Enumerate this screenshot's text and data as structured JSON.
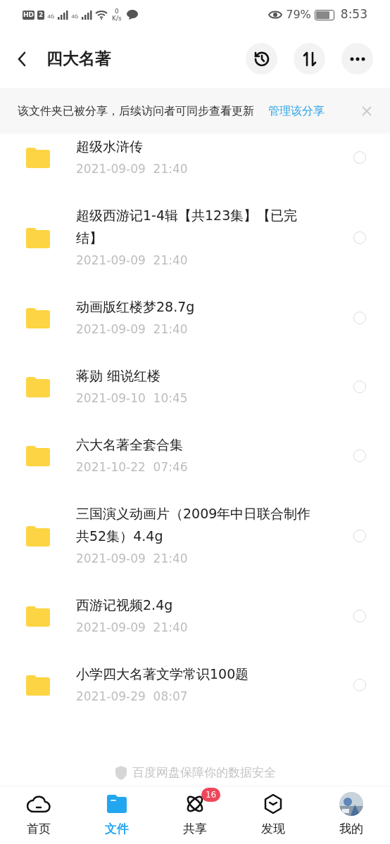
{
  "status_bar": {
    "hd": "HD",
    "sim": "2",
    "net1": "4G",
    "net2": "4G",
    "speed": "0",
    "speed_unit": "K/s",
    "battery": "79%",
    "time": "8:53"
  },
  "header": {
    "title": "四大名著"
  },
  "share_notice": {
    "text": "该文件夹已被分享，后续访问者可同步查看更新",
    "link": "管理该分享"
  },
  "files": [
    {
      "name": "超级水浒传",
      "date": "2021-09-09  21:40",
      "selected": false
    },
    {
      "name": "超级西游记1-4辑【共123集】【已完结】",
      "date": "2021-09-09  21:40",
      "selected": false
    },
    {
      "name": "动画版红楼梦28.7g",
      "date": "2021-09-09  21:40",
      "selected": false
    },
    {
      "name": "蒋勋 细说红楼",
      "date": "2021-09-10  10:45",
      "selected": false
    },
    {
      "name": "六大名著全套合集",
      "date": "2021-10-22  07:46",
      "selected": false
    },
    {
      "name": "三国演义动画片（2009年中日联合制作共52集）4.4g",
      "date": "2021-09-09  21:40",
      "selected": false
    },
    {
      "name": "西游记视频2.4g",
      "date": "2021-09-09  21:40",
      "selected": false
    },
    {
      "name": "小学四大名著文学常识100题",
      "date": "2021-09-29  08:07",
      "selected": false
    }
  ],
  "footer_note": "百度网盘保障你的数据安全",
  "tabs": [
    {
      "kind": "home",
      "label": "首页",
      "selected": false
    },
    {
      "kind": "files",
      "label": "文件",
      "selected": true
    },
    {
      "kind": "share",
      "label": "共享",
      "selected": false,
      "badge": "16"
    },
    {
      "kind": "discover",
      "label": "发现",
      "selected": false
    },
    {
      "kind": "me",
      "label": "我的",
      "selected": false
    }
  ]
}
